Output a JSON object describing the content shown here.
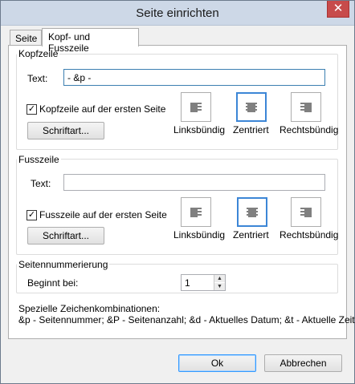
{
  "window": {
    "title": "Seite einrichten",
    "close_symbol": "✕"
  },
  "tabs": [
    {
      "label": "Seite"
    },
    {
      "label": "Kopf- und Fusszeile"
    }
  ],
  "header": {
    "group_title": "Kopfzeile",
    "text_label": "Text:",
    "text_value": "- &p -",
    "first_page_checkbox_label": "Kopfzeile auf der ersten Seite",
    "first_page_checked": true,
    "font_button": "Schriftart...",
    "align_left": "Linksbündig",
    "align_center": "Zentriert",
    "align_right": "Rechtsbündig",
    "selected_alignment": "center"
  },
  "footer": {
    "group_title": "Fusszeile",
    "text_label": "Text:",
    "text_value": "",
    "first_page_checkbox_label": "Fusszeile auf der ersten Seite",
    "first_page_checked": true,
    "font_button": "Schriftart...",
    "align_left": "Linksbündig",
    "align_center": "Zentriert",
    "align_right": "Rechtsbündig",
    "selected_alignment": "center"
  },
  "numbering": {
    "group_title": "Seitennummerierung",
    "start_label": "Beginnt bei:",
    "start_value": "1"
  },
  "special": {
    "heading": "Spezielle Zeichenkombinationen:",
    "codes": "&p - Seitennummer; &P - Seitenanzahl; &d - Aktuelles Datum; &t - Aktuelle Zeit."
  },
  "buttons": {
    "ok": "Ok",
    "cancel": "Abbrechen"
  },
  "colors": {
    "titlebar": "#cdd8e7",
    "close": "#c74b4b",
    "selected_border": "#3c86d6"
  }
}
